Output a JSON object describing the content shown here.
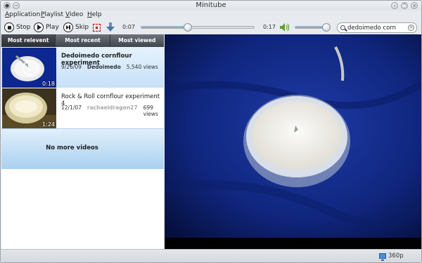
{
  "window": {
    "title": "Minitube"
  },
  "menu": [
    {
      "key": "A",
      "rest": "pplication"
    },
    {
      "key": "P",
      "rest": "laylist"
    },
    {
      "key": "V",
      "rest": "ideo"
    },
    {
      "key": "H",
      "rest": "elp"
    }
  ],
  "toolbar": {
    "stop_label": "Stop",
    "play_label": "Play",
    "skip_label": "Skip",
    "elapsed": "0:07",
    "duration": "0:17",
    "progress_fraction": 0.41,
    "volume_fraction": 0.95
  },
  "search": {
    "value": "dedoimedo corn"
  },
  "tabs": [
    "Most relevent",
    "Most recent",
    "Most viewed"
  ],
  "videos": [
    {
      "title": "Dedoimedo cornflour experiment",
      "date": "9/26/09",
      "author": "Dedoimedo",
      "views": "5,540 views",
      "duration": "0:18"
    },
    {
      "title": "Rock & Roll cornflour experiment 4",
      "date": "12/1/07",
      "author": "rachaeldragon27",
      "views": "699 views",
      "duration": "1:24"
    }
  ],
  "no_more": "No more videos",
  "status": {
    "quality": "360p"
  },
  "colors": {
    "accent": "#5a9ad3",
    "selection": "#c6e1f8",
    "video_bg": "#0b1e6e"
  }
}
